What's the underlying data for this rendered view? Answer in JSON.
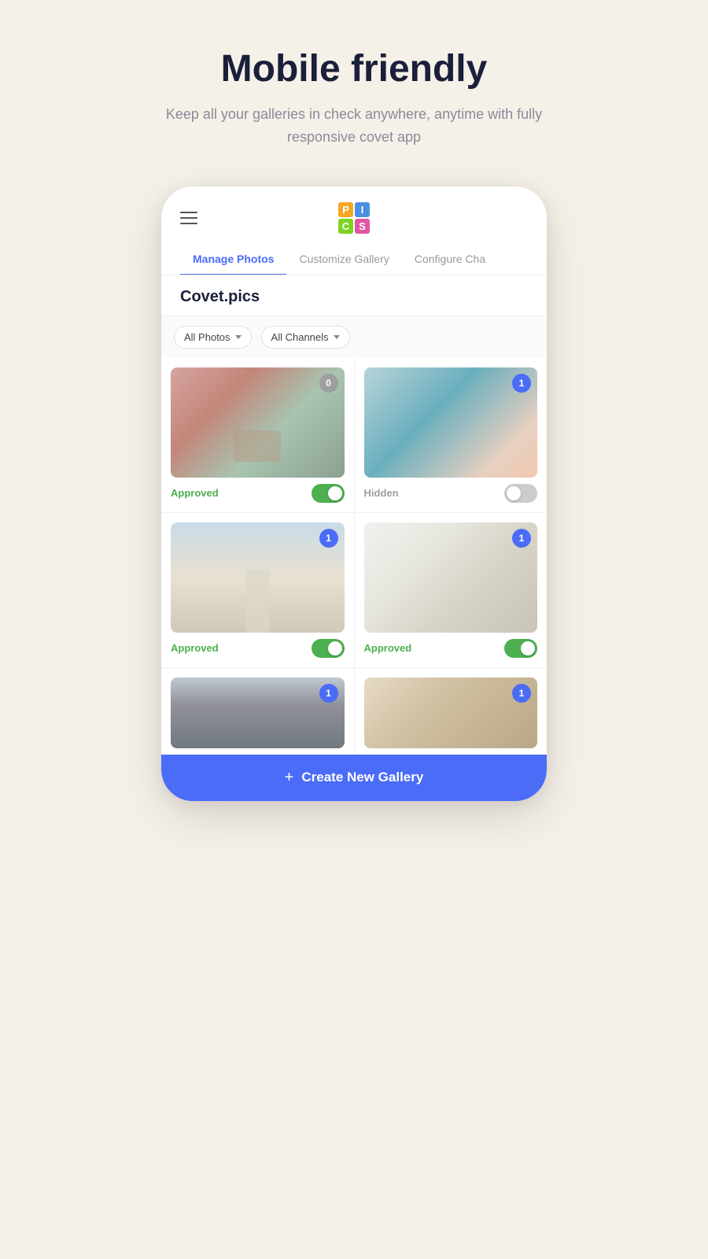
{
  "header": {
    "title": "Mobile friendly",
    "subtitle": "Keep all your galleries in check anywhere, anytime with fully responsive covet app"
  },
  "logo": {
    "cells": [
      {
        "letter": "P",
        "class": "logo-p"
      },
      {
        "letter": "I",
        "class": "logo-i"
      },
      {
        "letter": "C",
        "class": "logo-c"
      },
      {
        "letter": "S",
        "class": "logo-s"
      }
    ]
  },
  "tabs": [
    {
      "label": "Manage Photos",
      "active": true
    },
    {
      "label": "Customize Gallery",
      "active": false
    },
    {
      "label": "Configure Cha",
      "active": false
    }
  ],
  "gallery": {
    "title": "Covet.pics",
    "filters": {
      "photos_label": "All Photos",
      "channels_label": "All Channels"
    },
    "photos": [
      {
        "badge": "0",
        "badge_type": "gray",
        "status": "Approved",
        "status_type": "approved",
        "toggle": true
      },
      {
        "badge": "1",
        "badge_type": "blue",
        "status": "Hidden",
        "status_type": "hidden",
        "toggle": false
      },
      {
        "badge": "1",
        "badge_type": "blue",
        "status": "Approved",
        "status_type": "approved",
        "toggle": true
      },
      {
        "badge": "1",
        "badge_type": "blue",
        "status": "Approved",
        "status_type": "approved",
        "toggle": true
      },
      {
        "badge": "1",
        "badge_type": "blue",
        "status": "",
        "status_type": "approved",
        "toggle": true
      },
      {
        "badge": "1",
        "badge_type": "blue",
        "status": "",
        "status_type": "approved",
        "toggle": true
      }
    ]
  },
  "create_button": {
    "label": "Create New Gallery",
    "plus": "+"
  }
}
